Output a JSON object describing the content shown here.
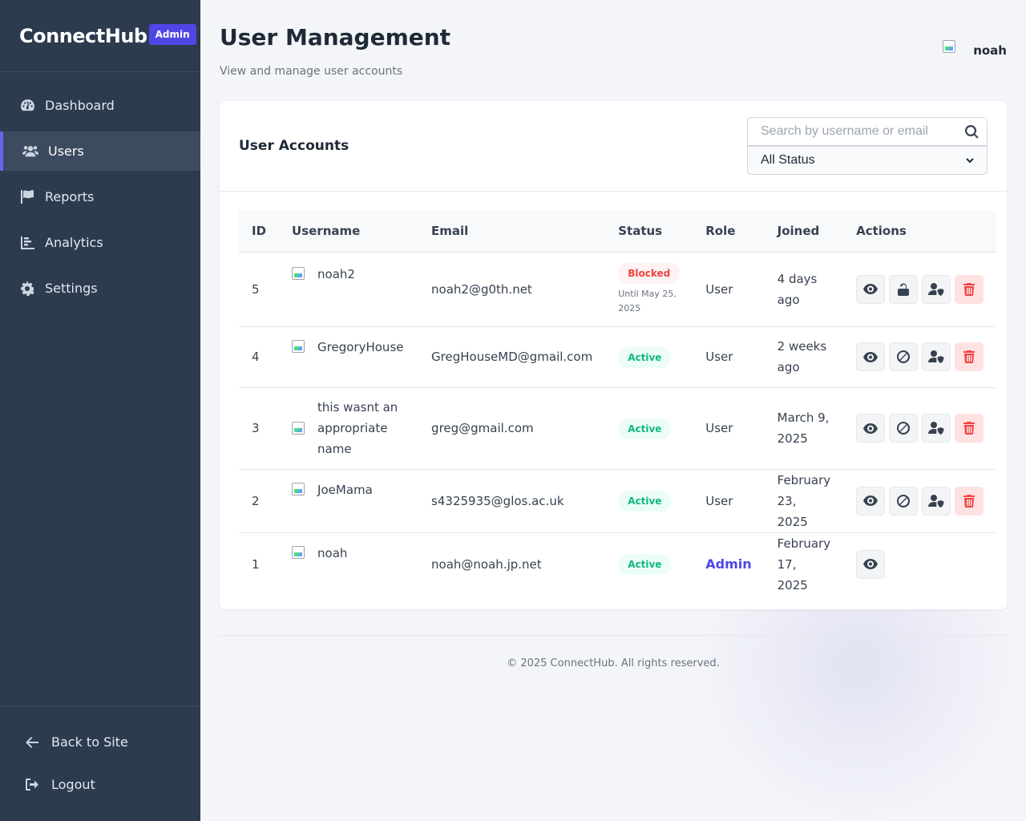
{
  "brand": {
    "name": "ConnectHub",
    "badge": "Admin"
  },
  "sidebar": {
    "items": [
      {
        "label": "Dashboard",
        "icon": "tachometer-icon"
      },
      {
        "label": "Users",
        "icon": "users-icon",
        "active": true
      },
      {
        "label": "Reports",
        "icon": "flag-icon"
      },
      {
        "label": "Analytics",
        "icon": "chart-bar-icon"
      },
      {
        "label": "Settings",
        "icon": "gear-icon"
      }
    ],
    "bottom": [
      {
        "label": "Back to Site",
        "icon": "arrow-left-icon"
      },
      {
        "label": "Logout",
        "icon": "sign-out-icon"
      }
    ]
  },
  "header": {
    "title": "User Management",
    "subtitle": "View and manage user accounts",
    "username": "noah"
  },
  "card": {
    "title": "User Accounts",
    "search_placeholder": "Search by username or email",
    "status_filter": "All Status"
  },
  "table": {
    "columns": [
      "ID",
      "Username",
      "Email",
      "Status",
      "Role",
      "Joined",
      "Actions"
    ],
    "rows": [
      {
        "id": "5",
        "username": "noah2",
        "email": "noah2@g0th.net",
        "status": "Blocked",
        "status_note": "Until May 25, 2025",
        "role": "User",
        "joined": "4 days ago"
      },
      {
        "id": "4",
        "username": "GregoryHouse",
        "email": "GregHouseMD@gmail.com",
        "status": "Active",
        "role": "User",
        "joined": "2 weeks ago"
      },
      {
        "id": "3",
        "username": "this wasnt an appropriate name",
        "email": "greg@gmail.com",
        "status": "Active",
        "role": "User",
        "joined": "March 9, 2025"
      },
      {
        "id": "2",
        "username": "JoeMama",
        "email": "s4325935@glos.ac.uk",
        "status": "Active",
        "role": "User",
        "joined": "February 23, 2025"
      },
      {
        "id": "1",
        "username": "noah",
        "email": "noah@noah.jp.net",
        "status": "Active",
        "role": "Admin",
        "joined": "February 17, 2025"
      }
    ]
  },
  "footer": {
    "text": "© 2025 ConnectHub. All rights reserved."
  },
  "colors": {
    "sidebar": "#2c3b4e",
    "accent": "#4f46e5",
    "active_green": "#10b981",
    "blocked_red": "#ef4444"
  }
}
